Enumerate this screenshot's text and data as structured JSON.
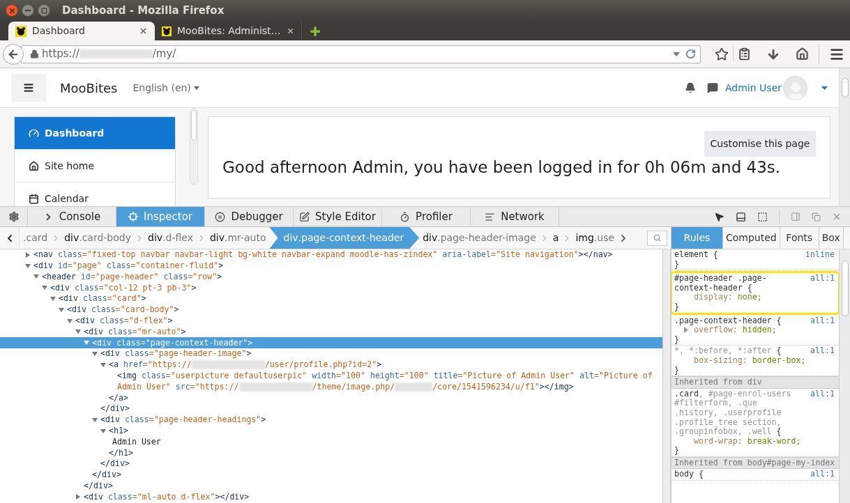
{
  "window": {
    "title": "Dashboard - Mozilla Firefox"
  },
  "tabs": [
    {
      "title": "Dashboard",
      "selected": true
    },
    {
      "title": "MooBites: Administ…",
      "selected": false
    }
  ],
  "url": {
    "parts": [
      {
        "kind": "text",
        "text": "https://"
      },
      {
        "kind": "redacted"
      },
      {
        "kind": "text",
        "text": "/my/"
      }
    ]
  },
  "site": {
    "name": "MooBites",
    "language": "English (en)",
    "user": "Admin User",
    "nav": [
      {
        "label": "Dashboard",
        "selected": true
      },
      {
        "label": "Site home",
        "selected": false
      },
      {
        "label": "Calendar",
        "selected": false
      }
    ],
    "customise_button": "Customise this page",
    "greeting": "Good afternoon Admin, you have been logged in for 0h 06m and 43s."
  },
  "devtools": {
    "tools": [
      {
        "label": "Console",
        "selected": false
      },
      {
        "label": "Inspector",
        "selected": true
      },
      {
        "label": "Debugger",
        "selected": false
      },
      {
        "label": "Style Editor",
        "selected": false
      },
      {
        "label": "Profiler",
        "selected": false
      },
      {
        "label": "Network",
        "selected": false
      }
    ],
    "breadcrumbs": [
      {
        "cls": ".card",
        "selected": false
      },
      {
        "tag": "div",
        "cls": ".card-body",
        "selected": false
      },
      {
        "tag": "div",
        "cls": ".d-flex",
        "selected": false
      },
      {
        "tag": "div",
        "cls": ".mr-auto",
        "selected": false
      },
      {
        "tag": "div",
        "cls": ".page-context-header",
        "selected": true
      },
      {
        "tag": "div",
        "cls": ".page-header-image",
        "selected": false
      },
      {
        "tag": "a",
        "selected": false
      },
      {
        "tag": "img",
        "cls": ".use",
        "selected": false
      }
    ],
    "sidebar_tabs": [
      {
        "label": "Rules",
        "selected": true
      },
      {
        "label": "Computed",
        "selected": false
      },
      {
        "label": "Fonts",
        "selected": false
      },
      {
        "label": "Box",
        "selected": false
      }
    ],
    "tree": [
      {
        "kind": "element",
        "open": "<nav",
        "attrs": [
          {
            "name": "class",
            "value": "=\"fixed-top navbar navbar-light bg-white navbar-expand moodle-has-zindex\""
          },
          {
            "name": "aria-label",
            "value": "=\"Site navigation\""
          }
        ],
        "end": "></nav>",
        "expanded": false,
        "selected": false
      },
      {
        "kind": "element",
        "open": "<div",
        "attrs": [
          {
            "name": "id",
            "value": "=\"page\""
          },
          {
            "name": "class",
            "value": "=\"container-fluid\""
          }
        ],
        "end": ">",
        "expanded": true,
        "selected": false,
        "children": [
          {
            "kind": "element",
            "open": "<header",
            "attrs": [
              {
                "name": "id",
                "value": "=\"page-header\""
              },
              {
                "name": "class",
                "value": "=\"row\""
              }
            ],
            "end": ">",
            "expanded": true,
            "selected": false,
            "children": [
              {
                "kind": "element",
                "open": "<div",
                "attrs": [
                  {
                    "name": "class",
                    "value": "=\"col-12 pt-3 pb-3\""
                  }
                ],
                "end": ">",
                "expanded": true,
                "selected": false,
                "children": [
                  {
                    "kind": "element",
                    "open": "<div",
                    "attrs": [
                      {
                        "name": "class",
                        "value": "=\"card\""
                      }
                    ],
                    "end": ">",
                    "expanded": true,
                    "selected": false,
                    "children": [
                      {
                        "kind": "element",
                        "open": "<div",
                        "attrs": [
                          {
                            "name": "class",
                            "value": "=\"card-body\""
                          }
                        ],
                        "end": ">",
                        "expanded": true,
                        "selected": false,
                        "children": [
                          {
                            "kind": "element",
                            "open": "<div",
                            "attrs": [
                              {
                                "name": "class",
                                "value": "=\"d-flex\""
                              }
                            ],
                            "end": ">",
                            "expanded": true,
                            "selected": false,
                            "children": [
                              {
                                "kind": "element",
                                "open": "<div",
                                "attrs": [
                                  {
                                    "name": "class",
                                    "value": "=\"mr-auto\""
                                  }
                                ],
                                "end": ">",
                                "expanded": true,
                                "selected": false,
                                "close": "</div>",
                                "children": [
                                  {
                                    "kind": "element",
                                    "open": "<div",
                                    "attrs": [
                                      {
                                        "name": "class",
                                        "value": "=\"page-context-header\""
                                      }
                                    ],
                                    "end": ">",
                                    "expanded": true,
                                    "selected": true,
                                    "close": "</div>",
                                    "children": [
                                      {
                                        "kind": "element",
                                        "open": "<div",
                                        "attrs": [
                                          {
                                            "name": "class",
                                            "value": "=\"page-header-image\""
                                          }
                                        ],
                                        "end": ">",
                                        "expanded": true,
                                        "selected": false,
                                        "close": "</div>",
                                        "children": [
                                          {
                                            "kind": "element",
                                            "open": "<a",
                                            "attrs": [
                                              {
                                                "name": "href",
                                                "parts": [
                                                  {
                                                    "kind": "text",
                                                    "text": "=\"https://"
                                                  },
                                                  {
                                                    "kind": "redacted"
                                                  },
                                                  {
                                                    "kind": "text",
                                                    "text": "/user/profile.php?id=2\""
                                                  }
                                                ]
                                              }
                                            ],
                                            "end": ">",
                                            "expanded": true,
                                            "selected": false,
                                            "close": "</a>",
                                            "children": [
                                              {
                                                "kind": "leaf",
                                                "open": "<img",
                                                "attrs": [
                                                  {
                                                    "name": "class",
                                                    "value": "=\"userpicture defaultuserpic\""
                                                  },
                                                  {
                                                    "name": "width",
                                                    "value": "=\"100\""
                                                  },
                                                  {
                                                    "name": "height",
                                                    "value": "=\"100\""
                                                  },
                                                  {
                                                    "name": "title",
                                                    "value": "=\"Picture of Admin User\""
                                                  },
                                                  {
                                                    "name": "alt",
                                                    "value": "=\"Picture of Admin User\""
                                                  },
                                                  {
                                                    "name": "src",
                                                    "parts": [
                                                      {
                                                        "kind": "text",
                                                        "text": "=\"https://"
                                                      },
                                                      {
                                                        "kind": "redacted"
                                                      },
                                                      {
                                                        "kind": "text",
                                                        "text": "/theme/image.php/"
                                                      },
                                                      {
                                                        "kind": "redacted"
                                                      },
                                                      {
                                                        "kind": "text",
                                                        "text": "/core/1541596234/u/f1\""
                                                      }
                                                    ]
                                                  }
                                                ],
                                                "end": "></img>",
                                                "selected": false
                                              }
                                            ]
                                          }
                                        ]
                                      },
                                      {
                                        "kind": "element",
                                        "open": "<div",
                                        "attrs": [
                                          {
                                            "name": "class",
                                            "value": "=\"page-header-headings\""
                                          }
                                        ],
                                        "end": ">",
                                        "expanded": true,
                                        "selected": false,
                                        "close": "</div>",
                                        "children": [
                                          {
                                            "kind": "element",
                                            "open": "<h1",
                                            "end": ">",
                                            "expanded": true,
                                            "selected": false,
                                            "close": "</h1>",
                                            "children": [
                                              {
                                                "kind": "text",
                                                "text": "Admin User"
                                              }
                                            ]
                                          }
                                        ]
                                      }
                                    ]
                                  }
                                ]
                              },
                              {
                                "kind": "element",
                                "open": "<div",
                                "attrs": [
                                  {
                                    "name": "class",
                                    "value": "=\"ml-auto d-flex\""
                                  }
                                ],
                                "end": "></div>",
                                "expanded": false,
                                "selected": false
                              }
                            ]
                          }
                        ]
                      }
                    ]
                  }
                ]
              }
            ]
          }
        ]
      }
    ],
    "rules": [
      {
        "kind": "rule",
        "selector": [
          {
            "text": "element {",
            "matched": true
          }
        ],
        "source": "inline",
        "highlighted": false,
        "close": "}"
      },
      {
        "kind": "rule",
        "selector": [
          {
            "text": "#page-header .page-context-header {",
            "matched": true
          }
        ],
        "source": "all:1",
        "highlighted": true,
        "declarations": [
          {
            "property": "display:",
            "value": "none;",
            "expandable": false
          }
        ],
        "close": "}"
      },
      {
        "kind": "rule",
        "selector": [
          {
            "text": ".page-context-header {",
            "matched": true
          }
        ],
        "source": "all:1",
        "highlighted": false,
        "declarations": [
          {
            "property": "overflow:",
            "value": "hidden;",
            "expandable": true
          }
        ],
        "close": "}"
      },
      {
        "kind": "rule",
        "selector": [
          {
            "text": "*, *:before, *:after",
            "matched": false
          },
          {
            "text": " {",
            "matched": true
          }
        ],
        "source": "all:1",
        "highlighted": false,
        "declarations": [
          {
            "property": "box-sizing:",
            "value": "border-box;",
            "expandable": false
          }
        ],
        "close": "}"
      },
      {
        "kind": "inherited",
        "label": "Inherited from div"
      },
      {
        "kind": "rule",
        "selector": [
          {
            "text": ".card",
            "matched": true
          },
          {
            "text": ", #page-enrol-users #filterform, .que .history, .userprofile .profile_tree section, .groupinfobox, .well",
            "matched": false
          },
          {
            "text": " {",
            "matched": true
          }
        ],
        "source": "all:1",
        "highlighted": false,
        "declarations": [
          {
            "property": "word-wrap:",
            "value": "break-word;",
            "expandable": false
          }
        ],
        "close": "}"
      },
      {
        "kind": "inherited",
        "label": "Inherited from body#page-my-index"
      },
      {
        "kind": "rule",
        "selector": [
          {
            "text": "body {",
            "matched": true
          }
        ],
        "source": "all:1",
        "highlighted": false
      }
    ]
  }
}
